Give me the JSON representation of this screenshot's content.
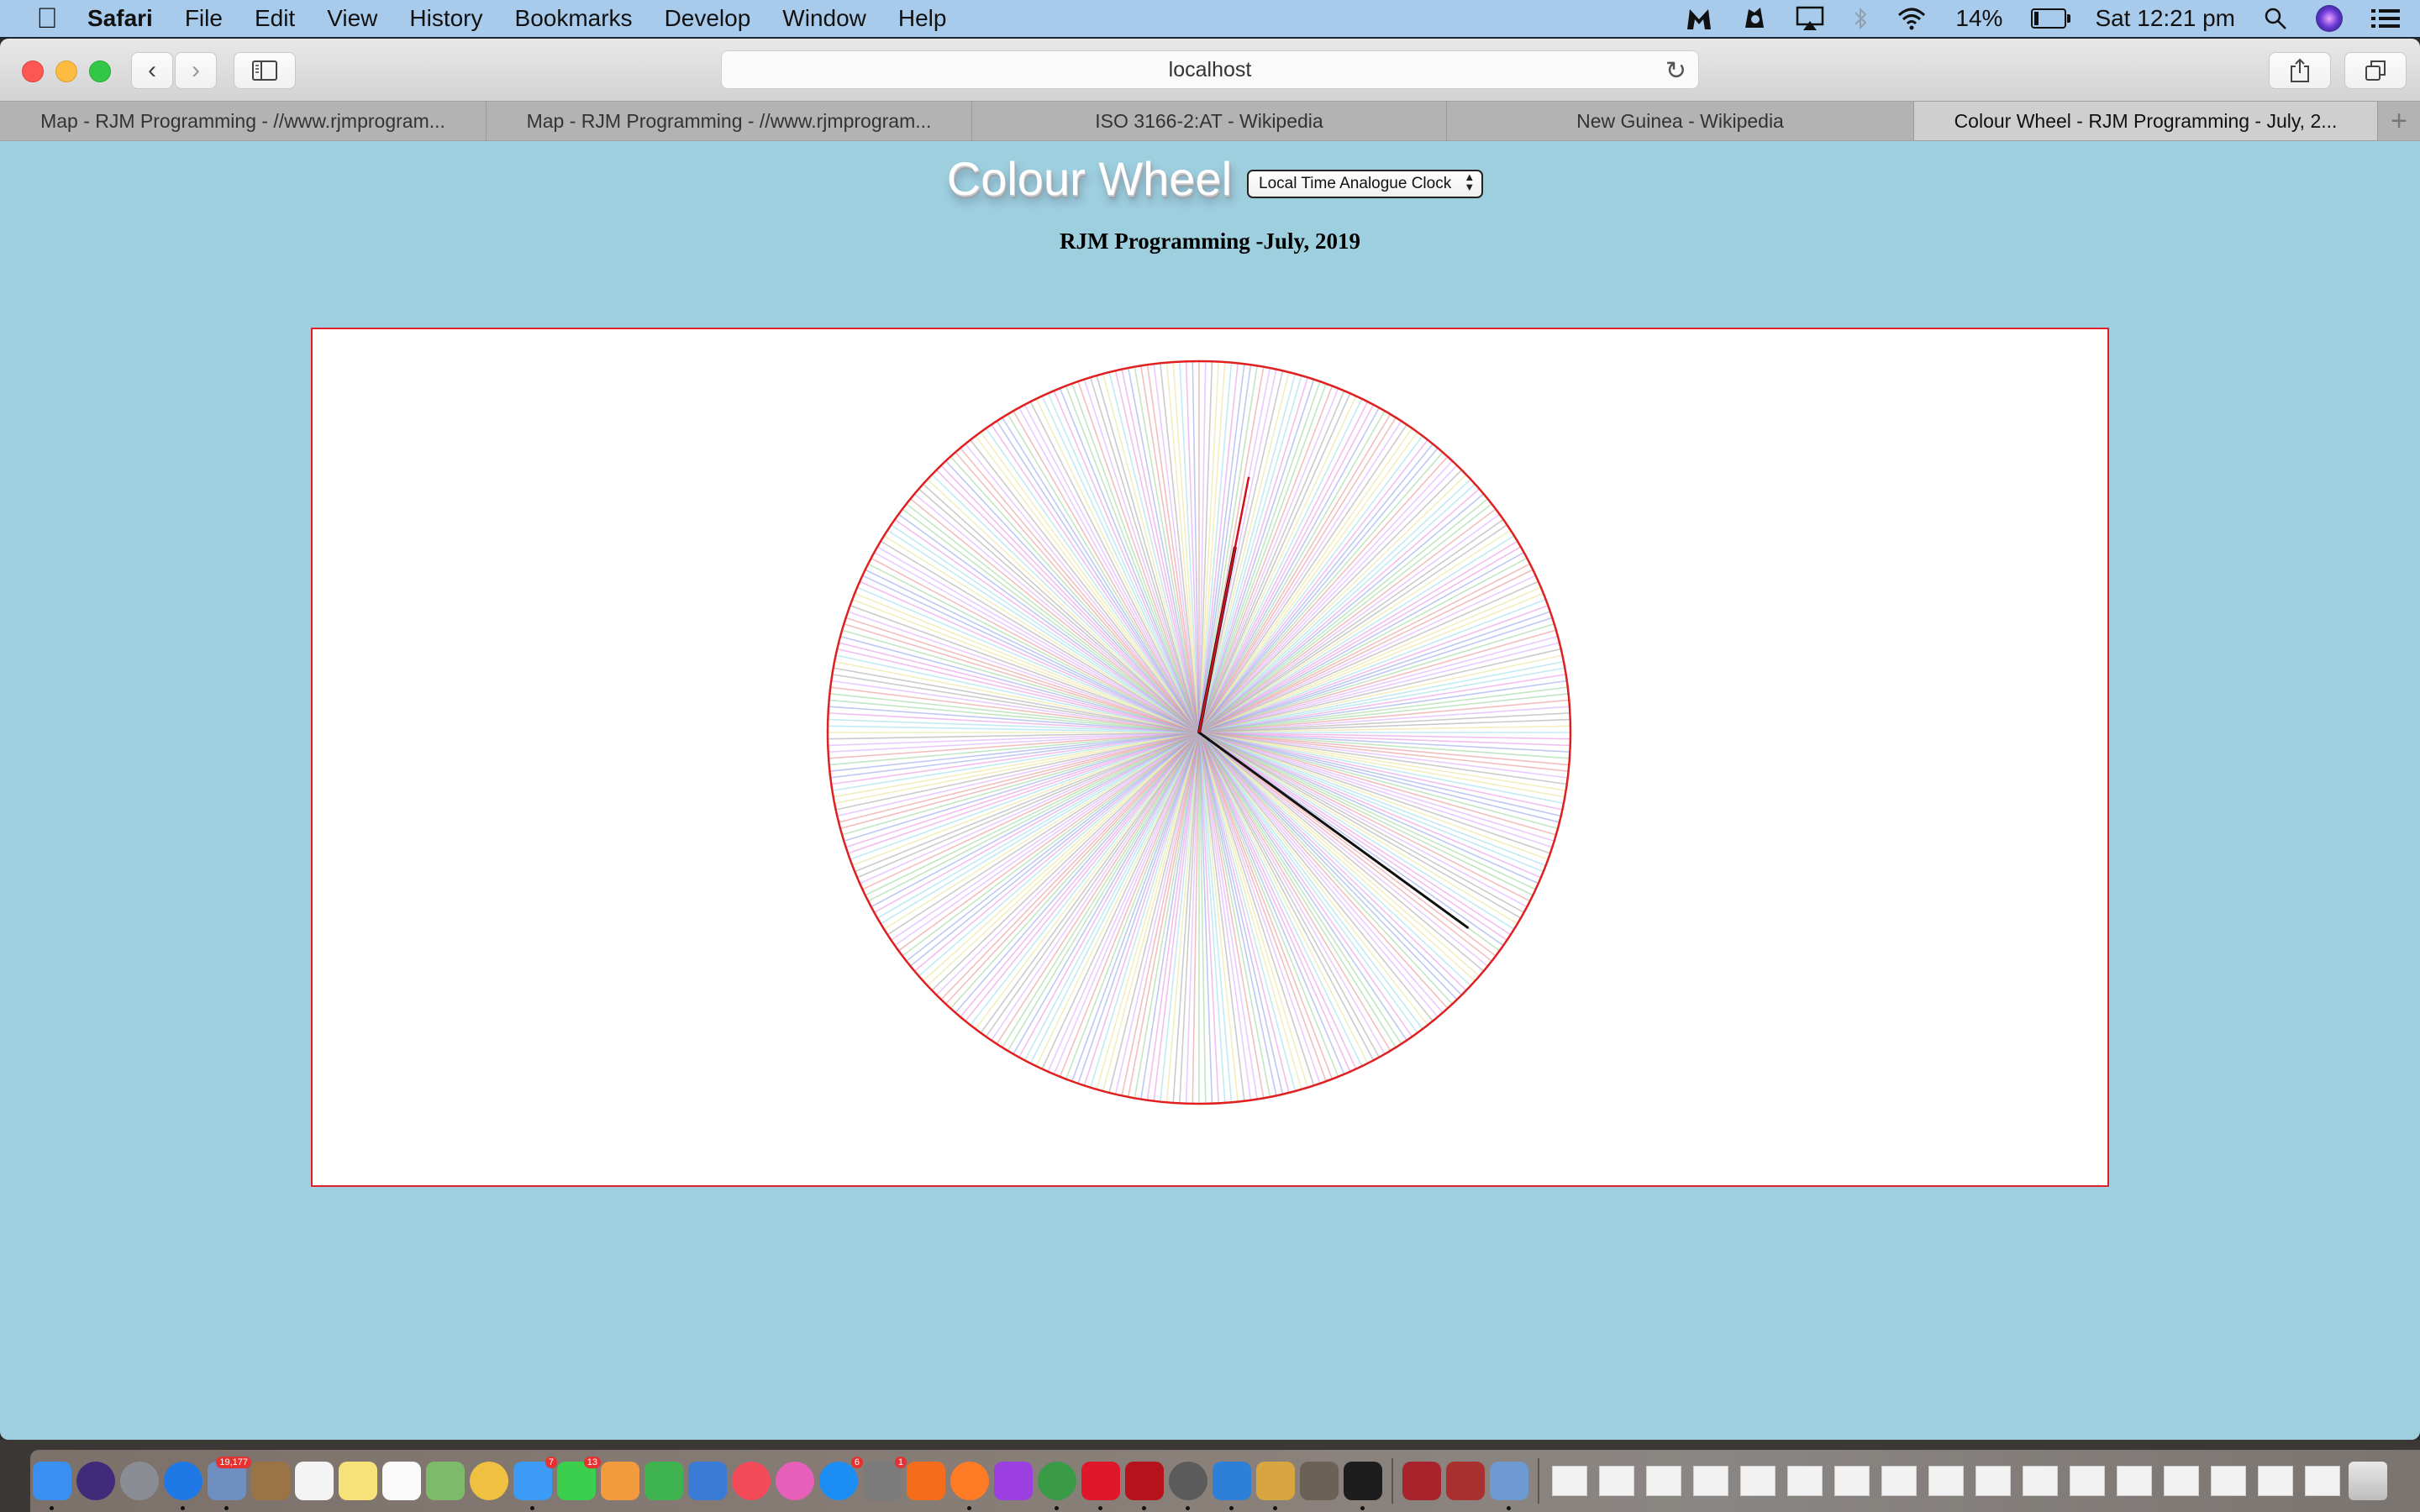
{
  "menubar": {
    "apple_icon": "apple-logo-icon",
    "app_name": "Safari",
    "items": [
      "File",
      "Edit",
      "View",
      "History",
      "Bookmarks",
      "Develop",
      "Window",
      "Help"
    ],
    "status": {
      "icons": [
        "malwarebytes-icon",
        "avast-icon",
        "airplay-icon",
        "bluetooth-icon",
        "wifi-icon"
      ],
      "battery_percent": "14%",
      "battery_level": 0.14,
      "clock": "Sat 12:21 pm",
      "right_icons": [
        "spotlight-search-icon",
        "siri-icon",
        "notification-center-icon"
      ]
    }
  },
  "toolbar": {
    "url": "localhost",
    "back_icon": "chevron-left-icon",
    "forward_icon": "chevron-right-icon",
    "sidebar_icon": "sidebar-icon",
    "reload_icon": "reload-icon",
    "share_icon": "share-icon",
    "tabs_overview_icon": "tabs-overview-icon"
  },
  "tabs": [
    {
      "label": "Map - RJM Programming - //www.rjmprogram...",
      "active": false
    },
    {
      "label": "Map - RJM Programming - //www.rjmprogram...",
      "active": false
    },
    {
      "label": "ISO 3166-2:AT - Wikipedia",
      "active": false
    },
    {
      "label": "New Guinea - Wikipedia",
      "active": false
    },
    {
      "label": "Colour Wheel - RJM Programming - July, 2...",
      "active": true
    }
  ],
  "new_tab_label": "+",
  "page": {
    "title": "Colour Wheel",
    "mode_select": {
      "selected": "Local Time Analogue Clock"
    },
    "subtitle": "RJM Programming -July, 2019"
  },
  "clock": {
    "time_shown": "12:21",
    "hour_hand_degrees": 11,
    "minute_hand_degrees": 126,
    "ray_count": 360,
    "ray_palette": [
      "#e88a8a",
      "#8fd18f",
      "#8a9ae8",
      "#e58ae0",
      "#8fd8e8",
      "#e8e08a",
      "#a0a0a0",
      "#d8a0ff"
    ],
    "circle_color": "#e02020",
    "border_color": "#e0202a"
  },
  "dock": {
    "apps": [
      {
        "name": "finder-icon",
        "color": "#3b8ff0",
        "running": true
      },
      {
        "name": "siri-icon",
        "color": "#402a7a"
      },
      {
        "name": "launchpad-icon",
        "color": "#8a8e94"
      },
      {
        "name": "safari-icon",
        "color": "#1e78e6",
        "running": true
      },
      {
        "name": "mail-icon",
        "color": "#6e8fbf",
        "badge": "19,177",
        "running": true
      },
      {
        "name": "contacts-icon",
        "color": "#9b7445"
      },
      {
        "name": "calendar-icon",
        "color": "#f4f4f4"
      },
      {
        "name": "notes-icon",
        "color": "#f7e27a"
      },
      {
        "name": "reminders-icon",
        "color": "#fafafa"
      },
      {
        "name": "maps-icon",
        "color": "#7dbb6a"
      },
      {
        "name": "photos-icon",
        "color": "#f0c040"
      },
      {
        "name": "messages-icon",
        "color": "#3c9bf5",
        "badge": "7",
        "running": true
      },
      {
        "name": "facetime-icon",
        "color": "#3ccf4e",
        "badge": "13"
      },
      {
        "name": "pages-icon",
        "color": "#f19a3e"
      },
      {
        "name": "numbers-icon",
        "color": "#3fb34f"
      },
      {
        "name": "keynote-icon",
        "color": "#3a7bd5"
      },
      {
        "name": "news-icon",
        "color": "#f34b5a"
      },
      {
        "name": "itunes-icon",
        "color": "#e65fb8"
      },
      {
        "name": "app-store-icon",
        "color": "#1c8df5",
        "badge": "6"
      },
      {
        "name": "system-preferences-icon",
        "color": "#7b7b7b",
        "badge": "1"
      },
      {
        "name": "avast-icon",
        "color": "#f56c1b"
      },
      {
        "name": "firefox-icon",
        "color": "#ff7b25",
        "running": true
      },
      {
        "name": "phpstorm-icon",
        "color": "#9b3fe0"
      },
      {
        "name": "chrome-icon",
        "color": "#3a9b46",
        "running": true
      },
      {
        "name": "opera-icon",
        "color": "#e0162b",
        "running": true
      },
      {
        "name": "filezilla-icon",
        "color": "#b5121b",
        "running": true
      },
      {
        "name": "mamp-icon",
        "color": "#5b5b5b",
        "running": true
      },
      {
        "name": "fetch-icon",
        "color": "#2d7fd8",
        "running": true
      },
      {
        "name": "drawing-app-icon",
        "color": "#d7a640",
        "running": true
      },
      {
        "name": "gimp-icon",
        "color": "#6b6256"
      },
      {
        "name": "terminal-icon",
        "color": "#1d1d1d",
        "running": true
      },
      {
        "name": "photo-booth-icon",
        "color": "#a8232c"
      },
      {
        "name": "dictionary-icon",
        "color": "#a8302e"
      },
      {
        "name": "preview-icon",
        "color": "#6d9ad0",
        "running": true
      }
    ],
    "minimized_count": 17,
    "trash_icon": "trash-icon"
  }
}
